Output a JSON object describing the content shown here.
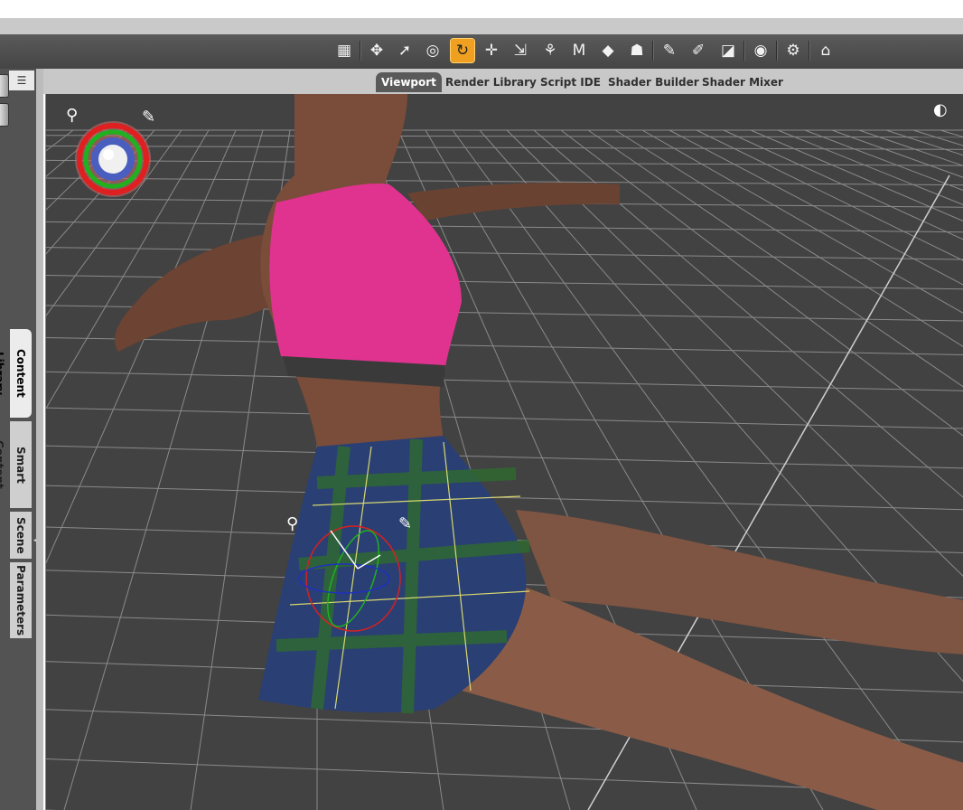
{
  "toolbar": {
    "tools": [
      {
        "name": "node-selection-icon",
        "glyph": "▦"
      },
      {
        "name": "universal-tool-icon",
        "glyph": "✥"
      },
      {
        "name": "pointer-tool-icon",
        "glyph": "➚"
      },
      {
        "name": "surface-selection-icon",
        "glyph": "◎"
      },
      {
        "name": "rotate-tool-icon",
        "glyph": "↻"
      },
      {
        "name": "translate-tool-icon",
        "glyph": "✛"
      },
      {
        "name": "scale-tool-icon",
        "glyph": "⇲"
      },
      {
        "name": "joint-editor-icon",
        "glyph": "⚘"
      },
      {
        "name": "geometry-editor-icon",
        "glyph": "Ⅿ"
      },
      {
        "name": "active-pose-tool-icon",
        "glyph": "◆"
      },
      {
        "name": "figure-tool-icon",
        "glyph": "☗"
      },
      {
        "name": "spot-render-tool-icon",
        "glyph": "✎"
      },
      {
        "name": "brush-tool-icon",
        "glyph": "✐"
      },
      {
        "name": "shader-brush-icon",
        "glyph": "◪"
      },
      {
        "name": "camera-tool-icon",
        "glyph": "◉"
      },
      {
        "name": "settings-pointer-icon",
        "glyph": "⚙"
      },
      {
        "name": "render-camera-icon",
        "glyph": "⌂"
      }
    ]
  },
  "tabs": [
    "Viewport",
    "Render Library",
    "Script IDE",
    "Shader Builder",
    "Shader Mixer"
  ],
  "active_tab": "Viewport",
  "side_tabs": [
    "Content Library",
    "Smart Content",
    "Scene",
    "Parameters"
  ],
  "active_side_tab": "Content Library",
  "viewport": {
    "background": "#424242",
    "grid_color": "#8a8a8a",
    "skin": "#8a5a44",
    "top_color": "#e0338f",
    "skirt_color": "#2a3f73"
  }
}
